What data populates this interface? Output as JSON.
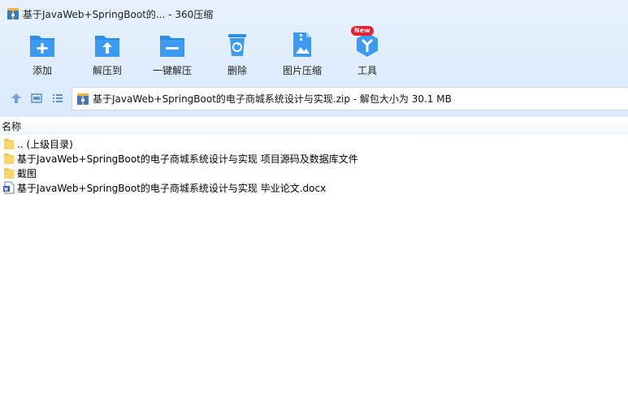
{
  "window": {
    "title": "基于JavaWeb+SpringBoot的... - 360压缩"
  },
  "toolbar": {
    "items": [
      {
        "label": "添加",
        "icon": "add-icon"
      },
      {
        "label": "解压到",
        "icon": "extract-to-icon"
      },
      {
        "label": "一键解压",
        "icon": "one-click-extract-icon"
      },
      {
        "label": "删除",
        "icon": "delete-icon"
      },
      {
        "label": "图片压缩",
        "icon": "image-compress-icon"
      },
      {
        "label": "工具",
        "icon": "tools-icon",
        "badge": "New"
      }
    ]
  },
  "nav": {
    "path": "基于JavaWeb+SpringBoot的电子商城系统设计与实现.zip - 解包大小为 30.1 MB"
  },
  "filelist": {
    "column_name": "名称",
    "rows": [
      {
        "name": ".. (上级目录)",
        "icon": "folder-icon"
      },
      {
        "name": "基于JavaWeb+SpringBoot的电子商城系统设计与实现 项目源码及数据库文件",
        "icon": "folder-icon"
      },
      {
        "name": "截图",
        "icon": "folder-icon"
      },
      {
        "name": "基于JavaWeb+SpringBoot的电子商城系统设计与实现 毕业论文.docx",
        "icon": "word-doc-icon"
      }
    ]
  },
  "colors": {
    "toolbar_blue": "#2d8de6",
    "header_bg": "#e2eefc",
    "badge_red": "#e8202b",
    "folder_yellow": "#f6c542"
  }
}
